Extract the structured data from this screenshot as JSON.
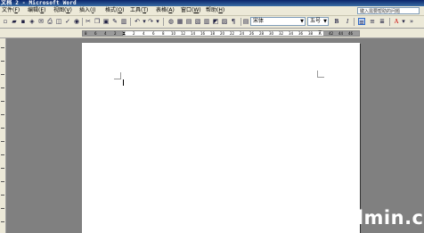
{
  "window": {
    "title": "文档 2 - Microsoft Word"
  },
  "menu": {
    "items": [
      {
        "label": "文件",
        "key": "F"
      },
      {
        "label": "编辑",
        "key": "E"
      },
      {
        "label": "视图",
        "key": "V"
      },
      {
        "label": "插入",
        "key": "I"
      },
      {
        "label": "格式",
        "key": "O"
      },
      {
        "label": "工具",
        "key": "T"
      },
      {
        "label": "表格",
        "key": "A"
      },
      {
        "label": "窗口",
        "key": "W"
      },
      {
        "label": "帮助",
        "key": "H"
      }
    ],
    "help_placeholder": "键入需要帮助的问题"
  },
  "toolbar": {
    "font_name": "宋体",
    "font_size": "五号",
    "bold": "B",
    "italic": "I",
    "font_color": "A"
  },
  "ruler": {
    "ticks": [
      "8",
      "6",
      "4",
      "2",
      "",
      "2",
      "4",
      "6",
      "8",
      "10",
      "12",
      "14",
      "16",
      "18",
      "20",
      "22",
      "24",
      "26",
      "28",
      "30",
      "32",
      "34",
      "36",
      "38",
      "",
      "42",
      "44",
      "46"
    ]
  },
  "watermark": {
    "text": "dmin.cc"
  }
}
